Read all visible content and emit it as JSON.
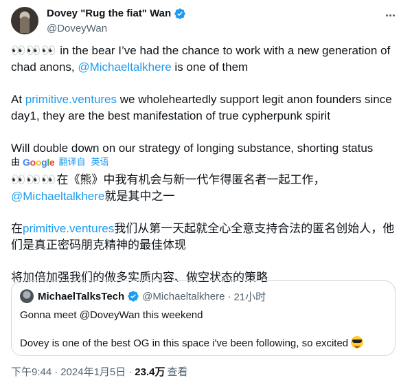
{
  "author": {
    "display_name": "Dovey \"Rug the fiat\" Wan",
    "handle": "@DoveyWan",
    "verified_icon": "verified-badge-icon",
    "avatar_icon": "avatar-photo"
  },
  "colors": {
    "link": "#1d9bf0",
    "text": "#0f1419",
    "muted": "#536471",
    "border": "#cfd9de"
  },
  "tweet": {
    "p1_eyes": "👀👀👀",
    "p1_text_a": " in the bear I’ve had the chance to work with a new generation of chad anons, ",
    "p1_mention": "@Michaeltalkhere",
    "p1_text_b": " is one of them",
    "p2_prefix": "At ",
    "p2_link": "primitive.ventures",
    "p2_text": " we wholeheartedly support legit anon founders since day1, they are the best manifestation of true cypherpunk spirit",
    "p3_text": "Will double down on our strategy of longing substance, shorting status"
  },
  "translation_bar": {
    "by": "由",
    "provider": "Google",
    "action": "翻译自",
    "language": "英语"
  },
  "translated": {
    "t1_eyes": "👀👀👀",
    "t1_text": "在《熊》中我有机会与新一代乍得匿名者一起工作，",
    "t1_mention": "@Michaeltalkhere",
    "t1_text_b": "就是其中之一",
    "t2_prefix": "在",
    "t2_link": "primitive.ventures",
    "t2_text": "我们从第一天起就全心全意支持合法的匿名创始人，他们是真正密码朋克精神的最佳体现",
    "t3_text": "将加倍加强我们的做多实质内容、做空状态的策略"
  },
  "quote": {
    "name": "MichaelTalksTech",
    "handle": "@Michaeltalkhere",
    "dot": "·",
    "time": "21小时",
    "line1": "Gonna meet @DoveyWan this weekend",
    "line2": "Dovey is one of the best OG in this space i've been following, so excited "
  },
  "meta": {
    "time": "下午9:44",
    "dot": "·",
    "date": "2024年1月5日",
    "dot2": "·",
    "views": "23.4万",
    "views_label": "查看"
  }
}
